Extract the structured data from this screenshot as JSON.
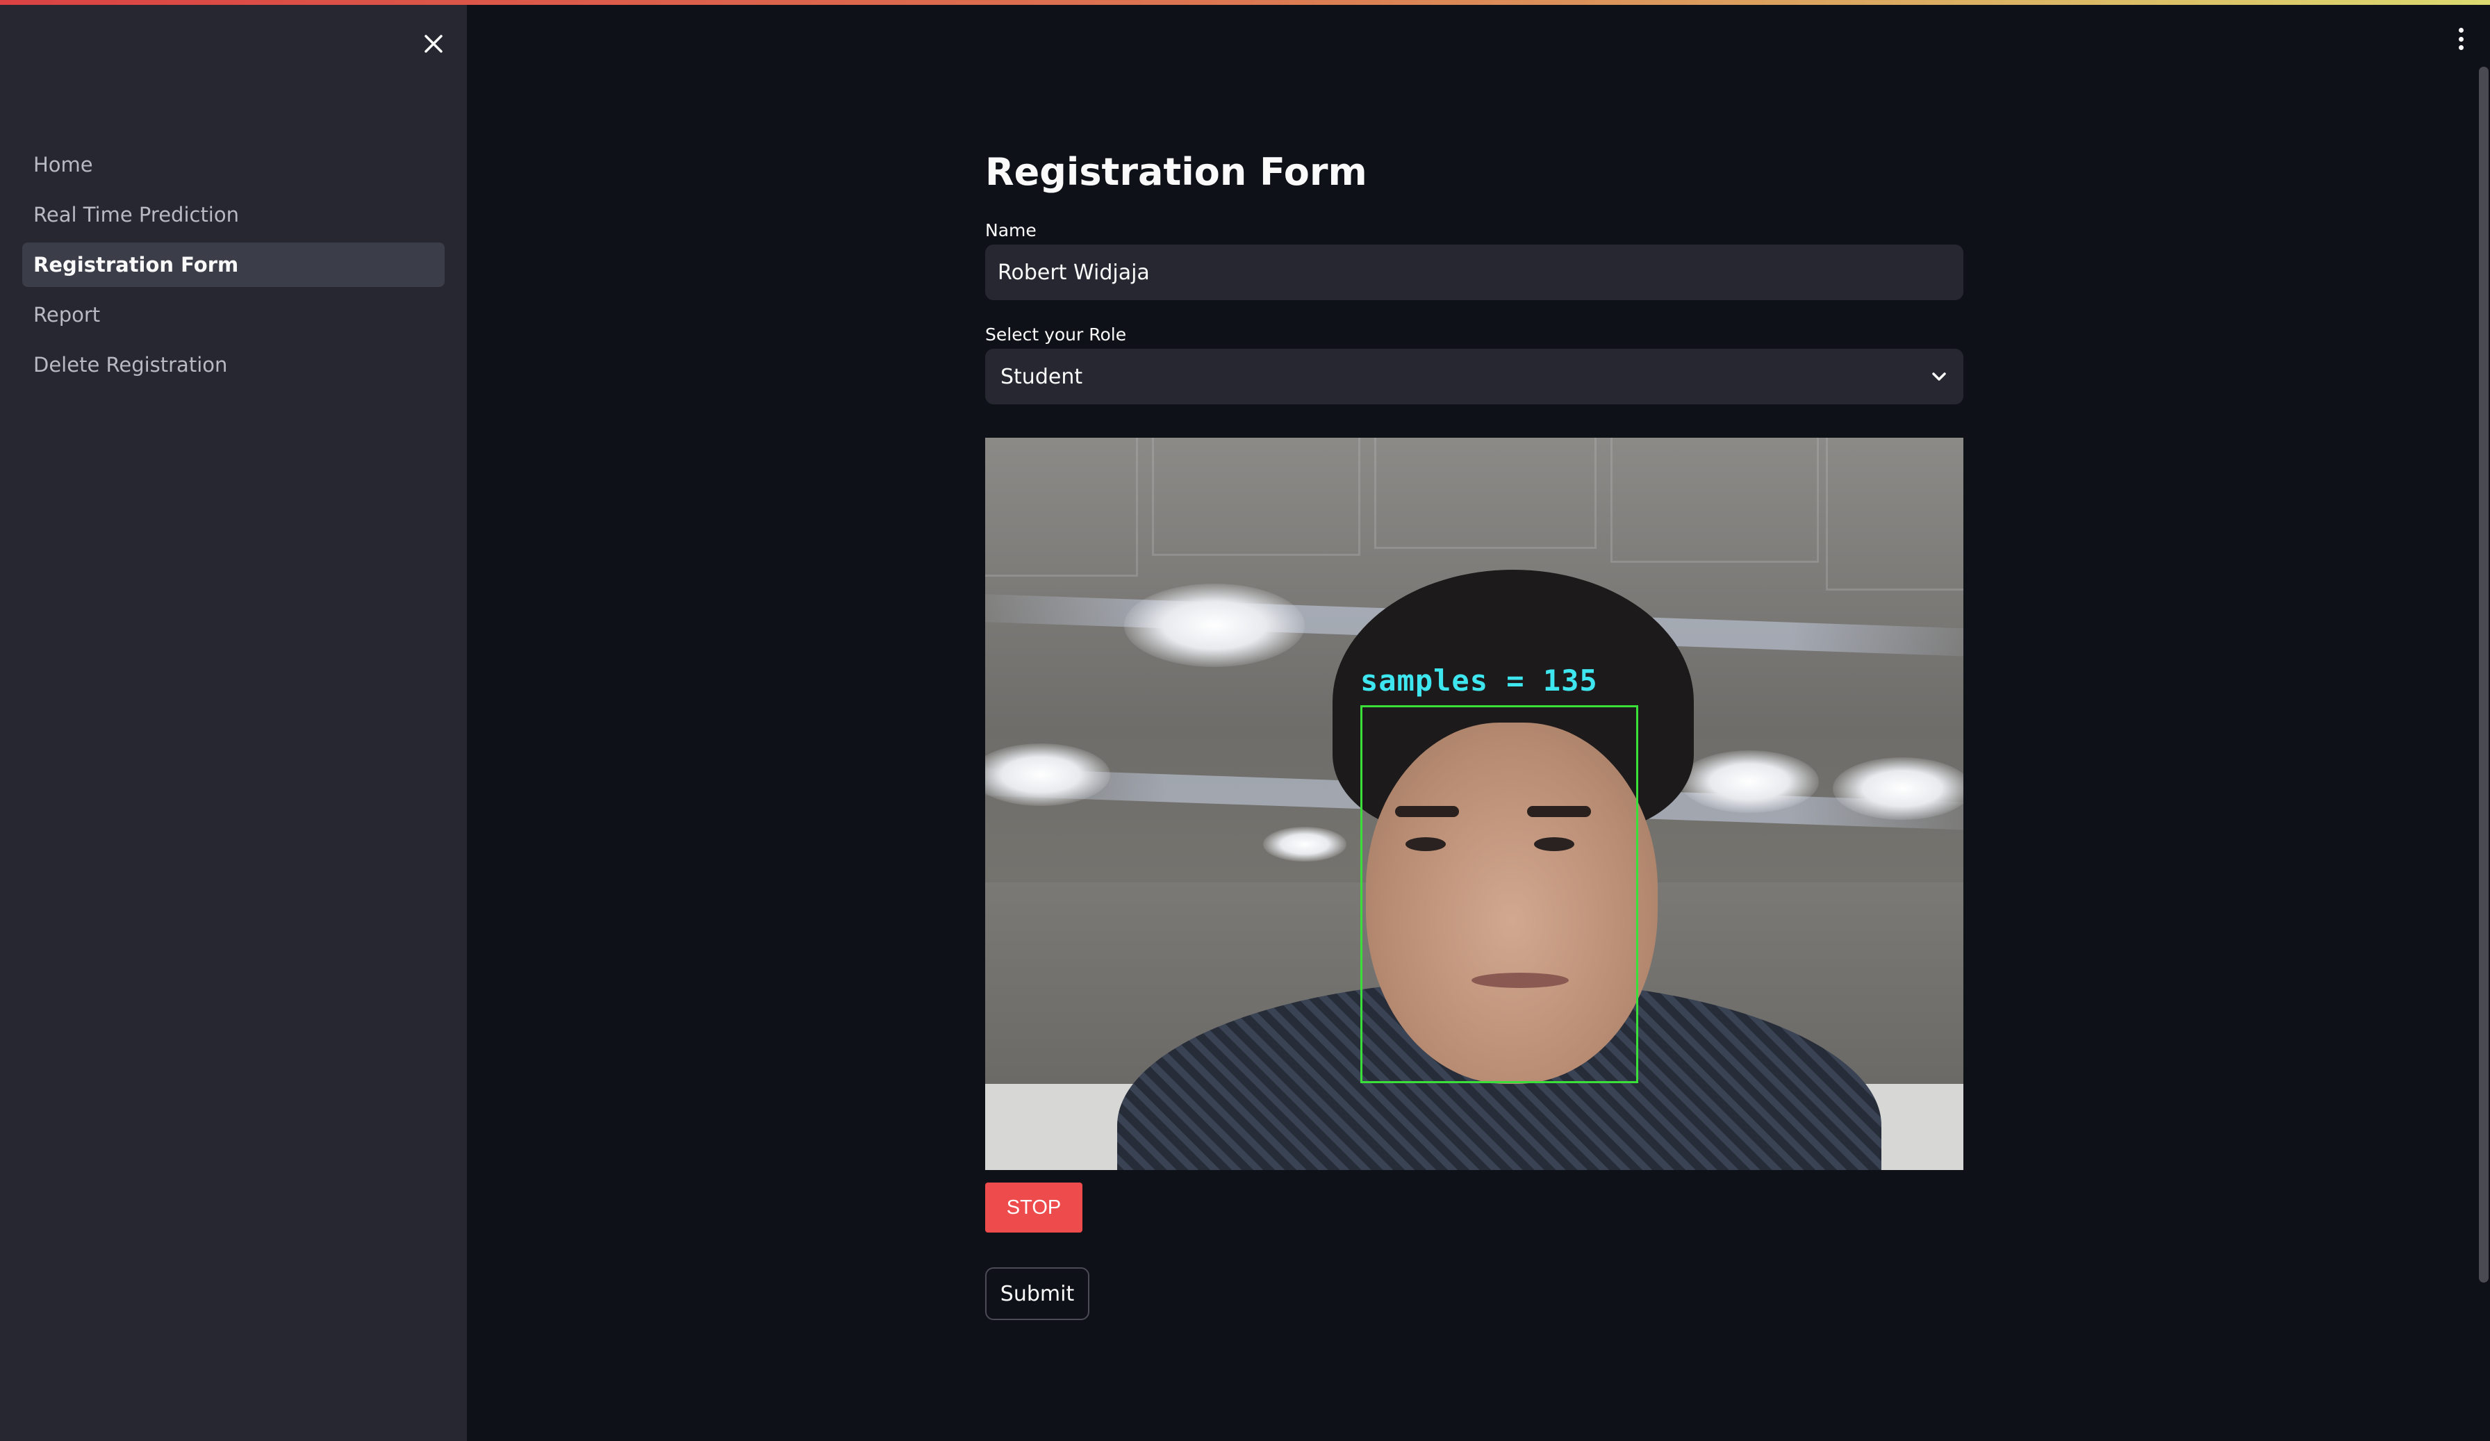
{
  "sidebar": {
    "close_icon": "close-icon",
    "items": [
      {
        "label": "Home"
      },
      {
        "label": "Real Time Prediction"
      },
      {
        "label": "Registration Form"
      },
      {
        "label": "Report"
      },
      {
        "label": "Delete Registration"
      }
    ],
    "active_index": 2
  },
  "header": {
    "menu_icon": "more-vertical-icon"
  },
  "main": {
    "title": "Registration Form",
    "name_label": "Name",
    "name_value": "Robert Widjaja",
    "role_label": "Select your Role",
    "role_value": "Student",
    "role_icon": "chevron-down-icon",
    "video_overlay_text": "samples = 135",
    "stop_label": "STOP",
    "submit_label": "Submit"
  },
  "colors": {
    "background": "#0e1117",
    "sidebar": "#262730",
    "stop_button": "#ee4c4c",
    "face_box": "#3adf3a",
    "overlay_text": "#3ee6f0"
  }
}
